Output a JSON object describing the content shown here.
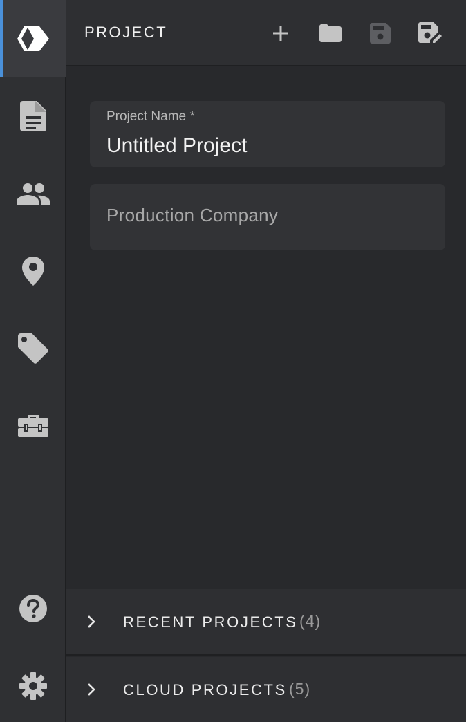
{
  "header": {
    "title": "PROJECT",
    "actions": [
      {
        "icon": "plus-icon"
      },
      {
        "icon": "folder-icon"
      },
      {
        "icon": "save-icon"
      },
      {
        "icon": "save-as-icon"
      }
    ]
  },
  "rail": {
    "items": [
      {
        "icon": "app-logo-icon",
        "active": true
      },
      {
        "icon": "document-icon"
      },
      {
        "icon": "people-icon"
      },
      {
        "icon": "location-pin-icon"
      },
      {
        "icon": "tag-icon"
      },
      {
        "icon": "toolbox-icon"
      },
      {
        "icon": "help-icon"
      },
      {
        "icon": "settings-gear-icon"
      }
    ]
  },
  "form": {
    "project_name": {
      "label": "Project Name *",
      "value": "Untitled Project"
    },
    "production_company": {
      "placeholder": "Production Company"
    }
  },
  "sections": [
    {
      "label": "RECENT PROJECTS",
      "count": "(4)"
    },
    {
      "label": "CLOUD PROJECTS",
      "count": "(5)"
    }
  ],
  "colors": {
    "accent": "#4a90d9",
    "icon": "#c4c4c4",
    "background": "#28292c"
  }
}
